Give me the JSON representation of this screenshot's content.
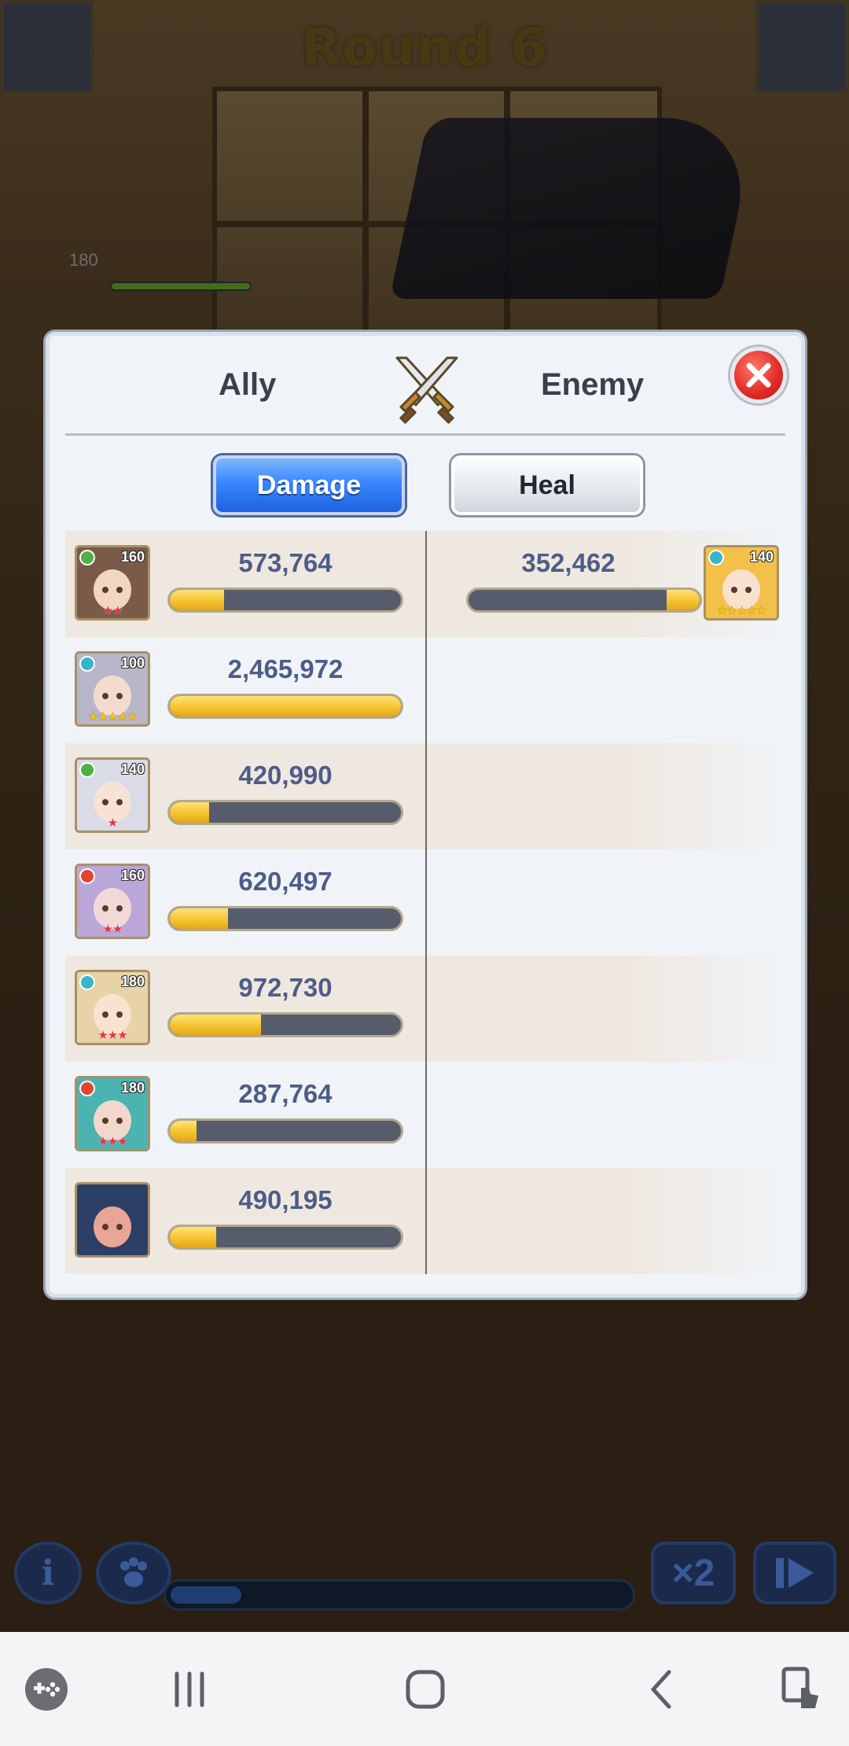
{
  "game": {
    "round_label": "Round 6",
    "ally_hp_level": "180"
  },
  "modal": {
    "ally_label": "Ally",
    "enemy_label": "Enemy",
    "tabs": [
      {
        "label": "Damage",
        "selected": true
      },
      {
        "label": "Heal",
        "selected": false
      }
    ]
  },
  "allies": [
    {
      "value": "573,764",
      "level": "160",
      "element": "wind",
      "element_color": "#4fb043",
      "stars": "★★",
      "star_color": "red",
      "fraction": 0.233
    },
    {
      "value": "2,465,972",
      "level": "100",
      "element": "water",
      "element_color": "#37b6c9",
      "stars": "★★★★★",
      "star_color": "gold",
      "fraction": 1.0
    },
    {
      "value": "420,990",
      "level": "140",
      "element": "wind",
      "element_color": "#4fb043",
      "stars": "★",
      "star_color": "red",
      "fraction": 0.171
    },
    {
      "value": "620,497",
      "level": "160",
      "element": "fire",
      "element_color": "#e0452f",
      "stars": "★★",
      "star_color": "red",
      "fraction": 0.252
    },
    {
      "value": "972,730",
      "level": "180",
      "element": "water",
      "element_color": "#37b6c9",
      "stars": "★★★",
      "star_color": "red",
      "fraction": 0.394
    },
    {
      "value": "287,764",
      "level": "180",
      "element": "fire",
      "element_color": "#e0452f",
      "stars": "★★★",
      "star_color": "red",
      "fraction": 0.117
    },
    {
      "value": "490,195",
      "level": "",
      "element": "",
      "element_color": "",
      "stars": "",
      "star_color": "red",
      "fraction": 0.199
    }
  ],
  "enemies": [
    {
      "value": "352,462",
      "level": "140",
      "element": "water",
      "element_color": "#37b6c9",
      "stars": "★★★★★",
      "star_color": "gold",
      "fraction": 0.143
    }
  ],
  "icons": {
    "swords": "crossed-swords-icon",
    "close": "close-icon",
    "nav": [
      "game-launcher-icon",
      "recent-apps-icon",
      "home-icon",
      "back-icon",
      "screen-touch-icon"
    ]
  },
  "colors": {
    "accent_blue": "#3a86ff",
    "bar_fill": "#f5c330",
    "close_red": "#e02a26"
  }
}
